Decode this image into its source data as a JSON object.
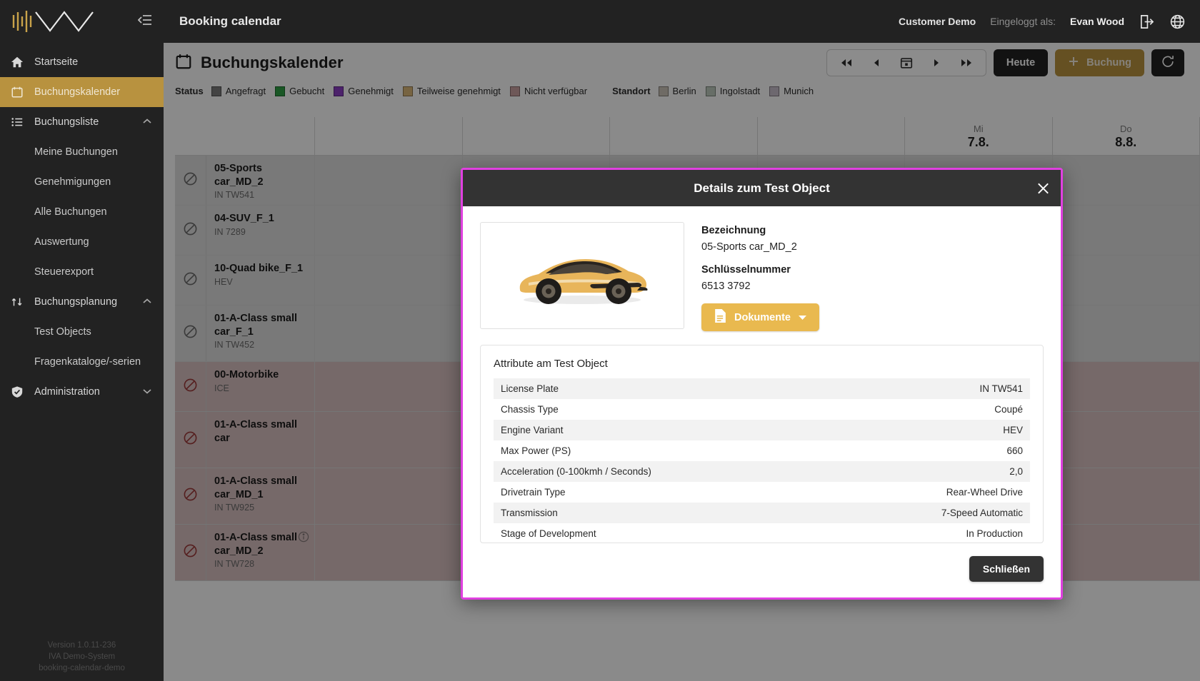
{
  "sidebar": {
    "logo_name": "iva-logo",
    "collapse_label": "collapse-sidebar",
    "items": [
      {
        "label": "Startseite",
        "icon": "home-icon",
        "type": "item",
        "active": false
      },
      {
        "label": "Buchungskalender",
        "icon": "calendar-icon",
        "type": "item",
        "active": true
      },
      {
        "label": "Buchungsliste",
        "icon": "list-icon",
        "type": "group",
        "expanded": true
      },
      {
        "label": "Meine Buchungen",
        "type": "sub"
      },
      {
        "label": "Genehmigungen",
        "type": "sub"
      },
      {
        "label": "Alle Buchungen",
        "type": "sub"
      },
      {
        "label": "Auswertung",
        "type": "sub"
      },
      {
        "label": "Steuerexport",
        "type": "sub"
      },
      {
        "label": "Buchungsplanung",
        "icon": "swap-icon",
        "type": "group",
        "expanded": true
      },
      {
        "label": "Test Objects",
        "type": "sub"
      },
      {
        "label": "Fragenkataloge/-serien",
        "type": "sub"
      },
      {
        "label": "Administration",
        "icon": "shield-check-icon",
        "type": "group",
        "expanded": false
      }
    ],
    "footer": {
      "version": "Version 1.0.11-236",
      "system": "IVA Demo-System",
      "instance": "booking-calendar-demo"
    }
  },
  "topbar": {
    "title": "Booking calendar",
    "customer": "Customer Demo",
    "logged_in_label": "Eingeloggt als:",
    "user": "Evan Wood",
    "logout_icon": "logout-icon",
    "language_icon": "globe-icon"
  },
  "page": {
    "icon": "calendar-icon",
    "title": "Buchungskalender",
    "nav": {
      "first_label": "◀◀",
      "prev_label": "◀",
      "today_picker_icon": "calendar-picker-icon",
      "next_label": "▶",
      "last_label": "▶▶"
    },
    "today_button": "Heute",
    "new_booking_button": "Buchung",
    "refresh_icon": "refresh-icon"
  },
  "legend": {
    "status_label": "Status",
    "status_items": [
      {
        "label": "Angefragt",
        "color": "#7c7c7c"
      },
      {
        "label": "Gebucht",
        "color": "#2f9e44"
      },
      {
        "label": "Genehmigt",
        "color": "#8b3fc4"
      },
      {
        "label": "Teilweise genehmigt",
        "color": "#d9b679"
      },
      {
        "label": "Nicht verfügbar",
        "color": "#c9a0a0"
      }
    ],
    "location_label": "Standort",
    "location_items": [
      {
        "label": "Berlin",
        "color": "#cbc4b8"
      },
      {
        "label": "Ingolstadt",
        "color": "#bcc9bc"
      },
      {
        "label": "Munich",
        "color": "#c6bdcb"
      }
    ]
  },
  "calendar": {
    "days": [
      {
        "dow": "Mi",
        "date": "7.8."
      },
      {
        "dow": "Do",
        "date": "8.8."
      }
    ],
    "rows": [
      {
        "name": "05-Sports car_MD_2",
        "sub": "IN TW541",
        "state": "ok",
        "info": false
      },
      {
        "name": "04-SUV_F_1",
        "sub": "IN 7289",
        "state": "ok",
        "info": false
      },
      {
        "name": "10-Quad bike_F_1",
        "sub": "HEV",
        "state": "ok",
        "info": false
      },
      {
        "name": "01-A-Class small car_F_1",
        "sub": "IN TW452",
        "state": "ok",
        "info": false
      },
      {
        "name": "00-Motorbike",
        "sub": "ICE",
        "state": "blocked",
        "info": false
      },
      {
        "name": "01-A-Class small car",
        "sub": "",
        "state": "blocked",
        "info": false
      },
      {
        "name": "01-A-Class small car_MD_1",
        "sub": "IN TW925",
        "state": "blocked",
        "info": false
      },
      {
        "name": "01-A-Class small car_MD_2",
        "sub": "IN TW728",
        "state": "blocked",
        "info": true
      }
    ]
  },
  "modal": {
    "title": "Details zum Test Object",
    "close_icon": "close-icon",
    "image_alt": "sports-car-image",
    "fields": [
      {
        "label": "Bezeichnung",
        "value": "05-Sports car_MD_2"
      },
      {
        "label": "Schlüsselnummer",
        "value": "6513 3792"
      }
    ],
    "documents_button": "Dokumente",
    "documents_icon": "document-icon",
    "attributes_title": "Attribute am Test Object",
    "attributes": [
      {
        "key": "License Plate",
        "value": "IN TW541"
      },
      {
        "key": "Chassis Type",
        "value": "Coupé"
      },
      {
        "key": "Engine Variant",
        "value": "HEV"
      },
      {
        "key": "Max Power (PS)",
        "value": "660"
      },
      {
        "key": "Acceleration (0-100kmh / Seconds)",
        "value": "2,0"
      },
      {
        "key": "Drivetrain Type",
        "value": "Rear-Wheel Drive"
      },
      {
        "key": "Transmission",
        "value": "7-Speed Automatic"
      },
      {
        "key": "Stage of Development",
        "value": "In Production"
      }
    ],
    "close_button": "Schließen"
  },
  "colors": {
    "accent_gold": "#b8923f",
    "modal_border": "#e040e0",
    "dark": "#222222"
  }
}
